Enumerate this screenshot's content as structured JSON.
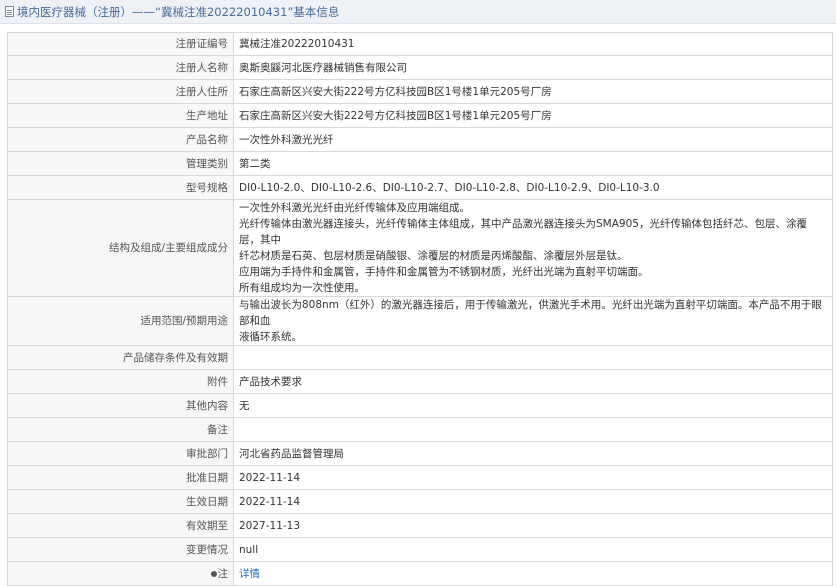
{
  "header": {
    "title": "境内医疗器械（注册）——“冀械注准20222010431”基本信息",
    "icon": "document-icon"
  },
  "rows": [
    {
      "label": "注册证编号",
      "value": "冀械注准20222010431"
    },
    {
      "label": "注册人名称",
      "value": "奥斯奥鼷河北医疗器械销售有限公司"
    },
    {
      "label": "注册人住所",
      "value": "石家庄高新区兴安大街222号方亿科技园B区1号楼1单元205号厂房"
    },
    {
      "label": "生产地址",
      "value": "石家庄高新区兴安大街222号方亿科技园B区1号楼1单元205号厂房"
    },
    {
      "label": "产品名称",
      "value": "一次性外科激光光纤"
    },
    {
      "label": "管理类别",
      "value": "第二类"
    },
    {
      "label": "型号规格",
      "value": "DI0-L10-2.0、DI0-L10-2.6、DI0-L10-2.7、DI0-L10-2.8、DI0-L10-2.9、DI0-L10-3.0"
    },
    {
      "label": "结构及组成/主要组成成分",
      "lines": [
        "一次性外科激光光纤由光纤传输体及应用端组成。",
        "光纤传输体由激光器连接头，光纤传输体主体组成，其中产品激光器连接头为SMA905，光纤传输体包括纤芯、包层、涂覆层，其中",
        "纤芯材质是石英、包层材质是硝酸银、涂覆层的材质是丙烯酸酯、涂覆层外层是钛。",
        "应用端为手持件和金属管，手持件和金属管为不锈钢材质，光纤出光端为直射平切端面。",
        "所有组成均为一次性使用。"
      ]
    },
    {
      "label": "适用范围/预期用途",
      "lines": [
        "与输出波长为808nm（红外）的激光器连接后，用于传输激光，供激光手术用。光纤出光端为直射平切端面。本产品不用于眼部和血",
        "液循环系统。"
      ]
    },
    {
      "label": "产品储存条件及有效期",
      "value": ""
    },
    {
      "label": "附件",
      "value": "产品技术要求"
    },
    {
      "label": "其他内容",
      "value": "无"
    },
    {
      "label": "备注",
      "value": ""
    },
    {
      "label": "审批部门",
      "value": "河北省药品监督管理局"
    },
    {
      "label": "批准日期",
      "value": "2022-11-14"
    },
    {
      "label": "生效日期",
      "value": "2022-11-14"
    },
    {
      "label": "有效期至",
      "value": "2027-11-13"
    },
    {
      "label": "变更情况",
      "value": "null"
    }
  ],
  "note_row": {
    "label": "注",
    "icon": "pin-icon",
    "link": "详情"
  }
}
